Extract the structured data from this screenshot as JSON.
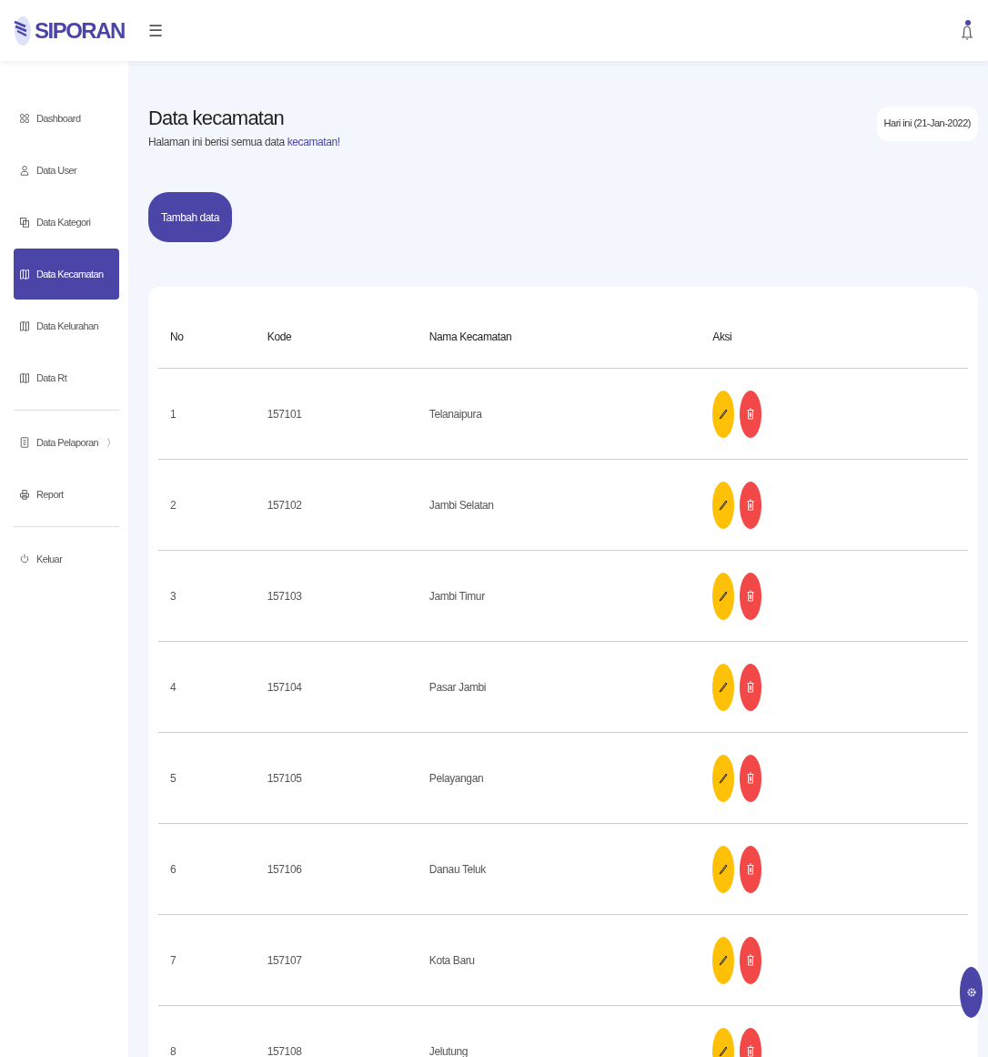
{
  "header": {
    "brand": "SIPORAN",
    "menu_glyph": "☰"
  },
  "sidebar": {
    "groups": [
      [
        {
          "label": "Dashboard",
          "kind": "grid",
          "selected": false
        },
        {
          "label": "Data User",
          "kind": "user",
          "selected": false
        },
        {
          "label": "Data Kategori",
          "kind": "copy",
          "selected": false
        },
        {
          "label": "Data Kecamatan",
          "kind": "map",
          "selected": true
        },
        {
          "label": "Data Kelurahan",
          "kind": "map",
          "selected": false
        },
        {
          "label": "Data Rt",
          "kind": "map",
          "selected": false
        }
      ],
      [
        {
          "label": "Data Pelaporan",
          "kind": "doc",
          "selected": false,
          "chevron": "〉"
        },
        {
          "label": "Report",
          "kind": "print",
          "selected": false
        }
      ],
      [
        {
          "label": "Keluar",
          "kind": "power",
          "selected": false
        }
      ]
    ]
  },
  "page": {
    "title": "Data kecamatan",
    "subtitle_prefix": "Halaman ini berisi semua data ",
    "subtitle_link": "kecamatan!",
    "date": "Hari ini (21-Jan-2022)",
    "add_button": "Tambah data"
  },
  "table": {
    "columns": [
      "No",
      "Kode",
      "Nama Kecamatan",
      "Aksi"
    ],
    "rows": [
      [
        "1",
        "157101",
        "Telanaipura"
      ],
      [
        "2",
        "157102",
        "Jambi Selatan"
      ],
      [
        "3",
        "157103",
        "Jambi Timur"
      ],
      [
        "4",
        "157104",
        "Pasar Jambi"
      ],
      [
        "5",
        "157105",
        "Pelayangan"
      ],
      [
        "6",
        "157106",
        "Danau Teluk"
      ],
      [
        "7",
        "157107",
        "Kota Baru"
      ],
      [
        "8",
        "157108",
        "Jelutung"
      ]
    ]
  }
}
